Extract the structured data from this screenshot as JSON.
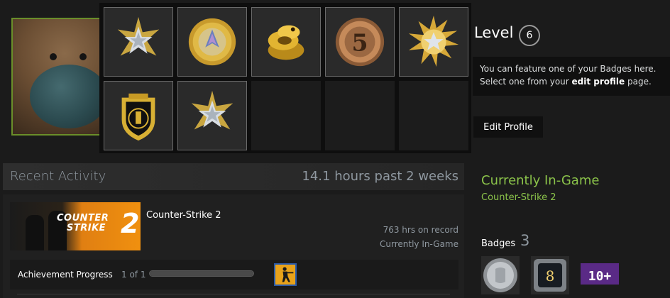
{
  "profile": {
    "level_label": "Level",
    "level_value": "6",
    "notice_prefix": "You can feature one of your Badges here. Select one from your ",
    "notice_link": "edit profile",
    "notice_suffix": " page.",
    "edit_button": "Edit Profile"
  },
  "badge_picker": {
    "slots": [
      {
        "icon": "service-medal-star-icon"
      },
      {
        "icon": "gold-coin-medal-icon"
      },
      {
        "icon": "gold-snake-medal-icon"
      },
      {
        "icon": "five-year-veteran-coin-icon",
        "text": "5"
      },
      {
        "icon": "sunburst-star-medal-icon"
      },
      {
        "icon": "cs-go-shield-badge-icon"
      },
      {
        "icon": "service-medal-star-icon"
      },
      {
        "icon": "empty"
      },
      {
        "icon": "empty"
      },
      {
        "icon": "empty"
      }
    ]
  },
  "recent_activity": {
    "title": "Recent Activity",
    "hours": "14.1 hours past 2 weeks",
    "game": {
      "name": "Counter-Strike 2",
      "capsule_text_line1": "COUNTER",
      "capsule_text_line2": "STRIKE",
      "capsule_number": "2",
      "hours_on_record": "763 hrs on record",
      "status": "Currently In-Game"
    },
    "achievements": {
      "label": "Achievement Progress",
      "count": "1 of 1",
      "progress": 1.0
    }
  },
  "sidebar": {
    "in_game_title": "Currently In-Game",
    "in_game_name": "Counter-Strike 2",
    "badges_label": "Badges",
    "badges_count": "3",
    "badge_icons": [
      "silver-coin-badge-icon",
      "eight-year-badge-icon",
      "ten-plus-badge-icon"
    ],
    "badge_texts": [
      "",
      "8",
      "10+"
    ]
  },
  "colors": {
    "in_game_green": "#8bc34a",
    "avatar_border": "#6a8e2a",
    "accent_orange": "#f0900f"
  }
}
